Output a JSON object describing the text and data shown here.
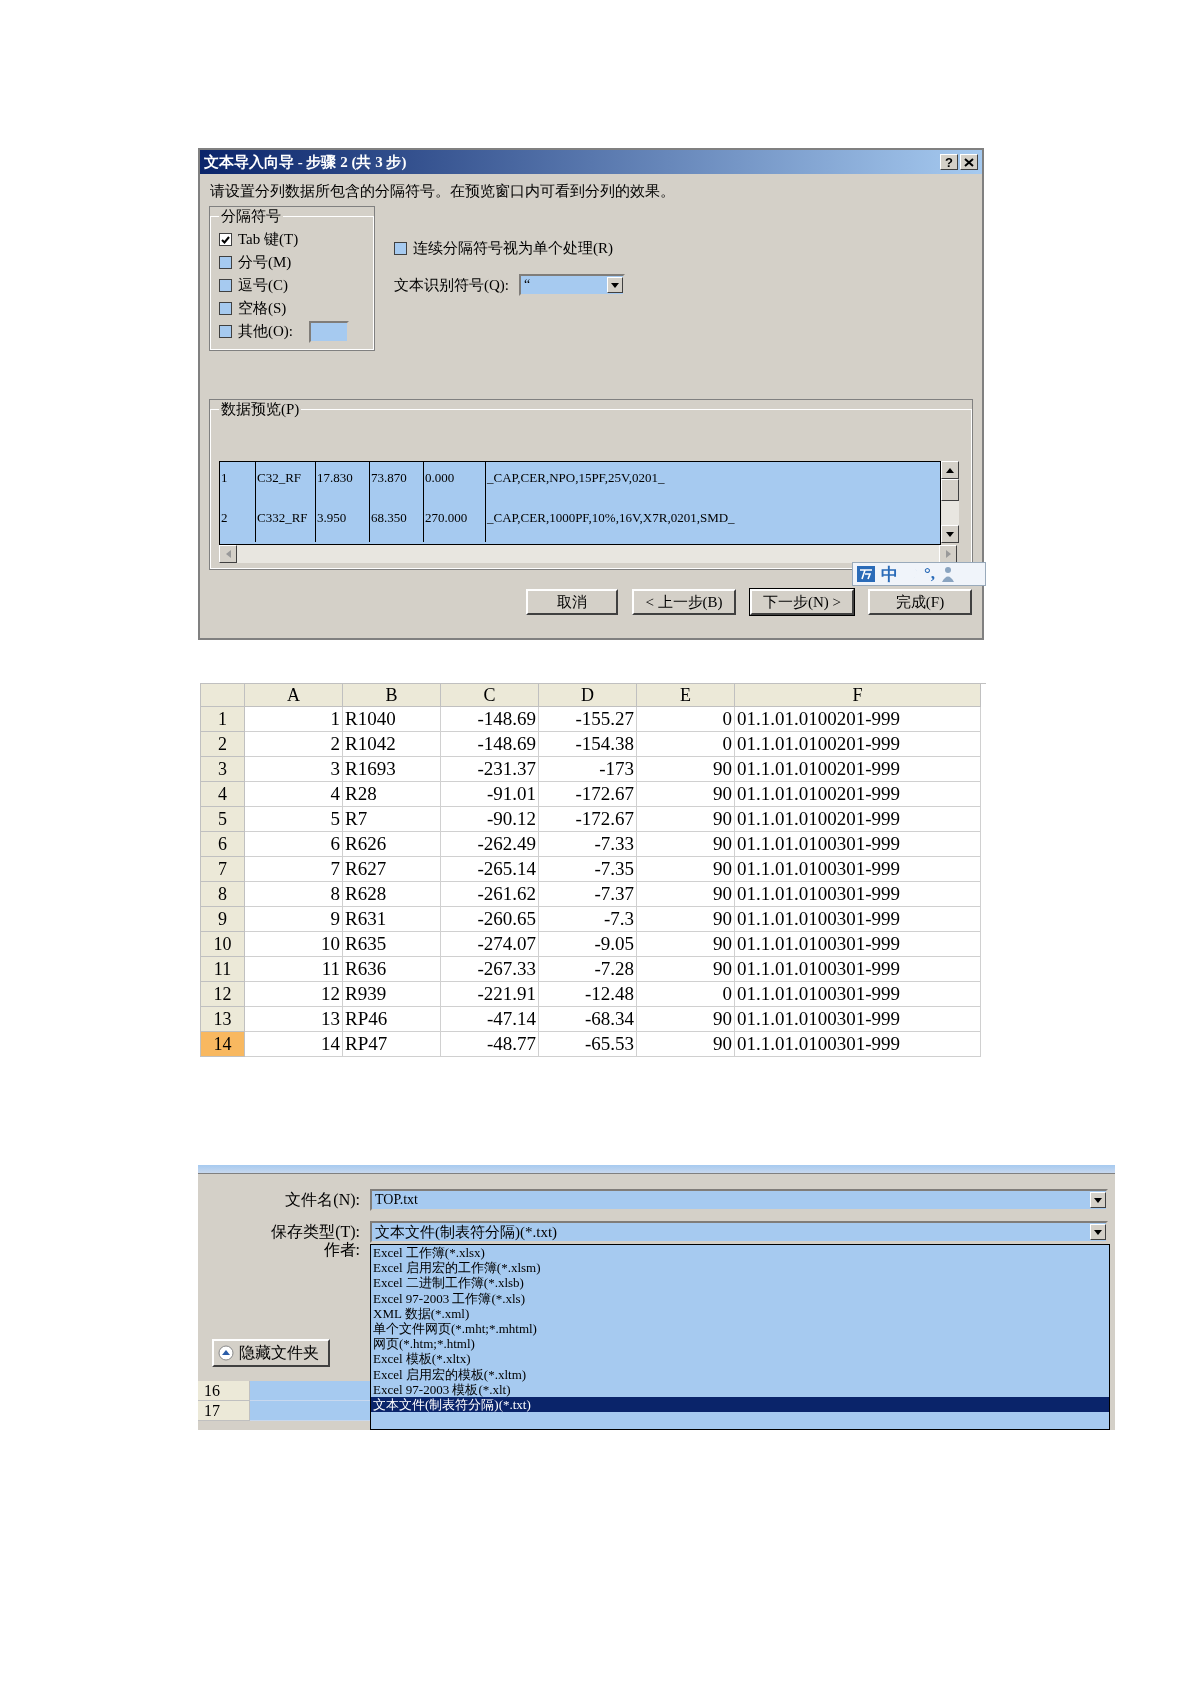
{
  "import_wizard": {
    "title": "文本导入向导 - 步骤 2 (共 3 步)",
    "help": "?",
    "instruction": "请设置分列数据所包含的分隔符号。在预览窗口内可看到分列的效果。",
    "delimiters": {
      "title": "分隔符号",
      "options": [
        {
          "label": "Tab 键(T)",
          "checked": true
        },
        {
          "label": "分号(M)",
          "checked": false
        },
        {
          "label": "逗号(C)",
          "checked": false
        },
        {
          "label": "空格(S)",
          "checked": false
        },
        {
          "label": "其他(O):",
          "checked": false,
          "kind": "other"
        }
      ]
    },
    "consecutive": {
      "label": "连续分隔符号视为单个处理(R)",
      "checked": false
    },
    "qualifier": {
      "label": "文本识别符号(Q):",
      "value": "“"
    },
    "preview": {
      "title": "数据预览(P)",
      "rows": [
        [
          "1",
          "C32_RF",
          "17.830",
          "73.870",
          "0.000",
          "_CAP,CER,NPO,15PF,25V,0201_"
        ],
        [
          "2",
          "C332_RF",
          "3.950",
          "68.350",
          "270.000",
          "_CAP,CER,1000PF,10%,16V,X7R,0201,SMD_"
        ]
      ]
    },
    "buttons": [
      {
        "label": "取消",
        "default": false
      },
      {
        "label": "< 上一步(B)",
        "default": false
      },
      {
        "label": "下一步(N) >",
        "default": true
      },
      {
        "label": "完成(F)",
        "default": false
      }
    ],
    "ime_bar": {
      "glyphs": [
        "中",
        "°,"
      ]
    }
  },
  "spreadsheet": {
    "columns": [
      "A",
      "B",
      "C",
      "D",
      "E",
      "F"
    ],
    "rows": [
      {
        "header": "1",
        "selected": false,
        "cells": [
          "1",
          "R1040",
          "-148.69",
          "-155.27",
          "0",
          "01.1.01.0100201-999"
        ]
      },
      {
        "header": "2",
        "selected": false,
        "cells": [
          "2",
          "R1042",
          "-148.69",
          "-154.38",
          "0",
          "01.1.01.0100201-999"
        ]
      },
      {
        "header": "3",
        "selected": false,
        "cells": [
          "3",
          "R1693",
          "-231.37",
          "-173",
          "90",
          "01.1.01.0100201-999"
        ]
      },
      {
        "header": "4",
        "selected": false,
        "cells": [
          "4",
          "R28",
          "-91.01",
          "-172.67",
          "90",
          "01.1.01.0100201-999"
        ]
      },
      {
        "header": "5",
        "selected": false,
        "cells": [
          "5",
          "R7",
          "-90.12",
          "-172.67",
          "90",
          "01.1.01.0100201-999"
        ]
      },
      {
        "header": "6",
        "selected": false,
        "cells": [
          "6",
          "R626",
          "-262.49",
          "-7.33",
          "90",
          "01.1.01.0100301-999"
        ]
      },
      {
        "header": "7",
        "selected": false,
        "cells": [
          "7",
          "R627",
          "-265.14",
          "-7.35",
          "90",
          "01.1.01.0100301-999"
        ]
      },
      {
        "header": "8",
        "selected": false,
        "cells": [
          "8",
          "R628",
          "-261.62",
          "-7.37",
          "90",
          "01.1.01.0100301-999"
        ]
      },
      {
        "header": "9",
        "selected": false,
        "cells": [
          "9",
          "R631",
          "-260.65",
          "-7.3",
          "90",
          "01.1.01.0100301-999"
        ]
      },
      {
        "header": "10",
        "selected": false,
        "cells": [
          "10",
          "R635",
          "-274.07",
          "-9.05",
          "90",
          "01.1.01.0100301-999"
        ]
      },
      {
        "header": "11",
        "selected": false,
        "cells": [
          "11",
          "R636",
          "-267.33",
          "-7.28",
          "90",
          "01.1.01.0100301-999"
        ]
      },
      {
        "header": "12",
        "selected": false,
        "cells": [
          "12",
          "R939",
          "-221.91",
          "-12.48",
          "0",
          "01.1.01.0100301-999"
        ]
      },
      {
        "header": "13",
        "selected": false,
        "cells": [
          "13",
          "RP46",
          "-47.14",
          "-68.34",
          "90",
          "01.1.01.0100301-999"
        ]
      },
      {
        "header": "14",
        "selected": true,
        "cells": [
          "14",
          "RP47",
          "-48.77",
          "-65.53",
          "90",
          "01.1.01.0100301-999"
        ]
      }
    ]
  },
  "save_dialog": {
    "filename_label": "文件名(N):",
    "filename": "TOP.txt",
    "type_label": "保存类型(T):",
    "type_value": "文本文件(制表符分隔)(*.txt)",
    "author_label": "作者:",
    "hide_folders": "隐藏文件夹",
    "row_headers": [
      "16",
      "17"
    ],
    "type_options": [
      {
        "label": "Excel 工作簿(*.xlsx)",
        "selected": false
      },
      {
        "label": "Excel 启用宏的工作簿(*.xlsm)",
        "selected": false
      },
      {
        "label": "Excel 二进制工作簿(*.xlsb)",
        "selected": false
      },
      {
        "label": "Excel 97-2003 工作簿(*.xls)",
        "selected": false
      },
      {
        "label": "XML 数据(*.xml)",
        "selected": false
      },
      {
        "label": "单个文件网页(*.mht;*.mhtml)",
        "selected": false
      },
      {
        "label": "网页(*.htm;*.html)",
        "selected": false
      },
      {
        "label": "Excel 模板(*.xltx)",
        "selected": false
      },
      {
        "label": "Excel 启用宏的模板(*.xltm)",
        "selected": false
      },
      {
        "label": "Excel 97-2003 模板(*.xlt)",
        "selected": false
      },
      {
        "label": "文本文件(制表符分隔)(*.txt)",
        "selected": true
      }
    ]
  }
}
